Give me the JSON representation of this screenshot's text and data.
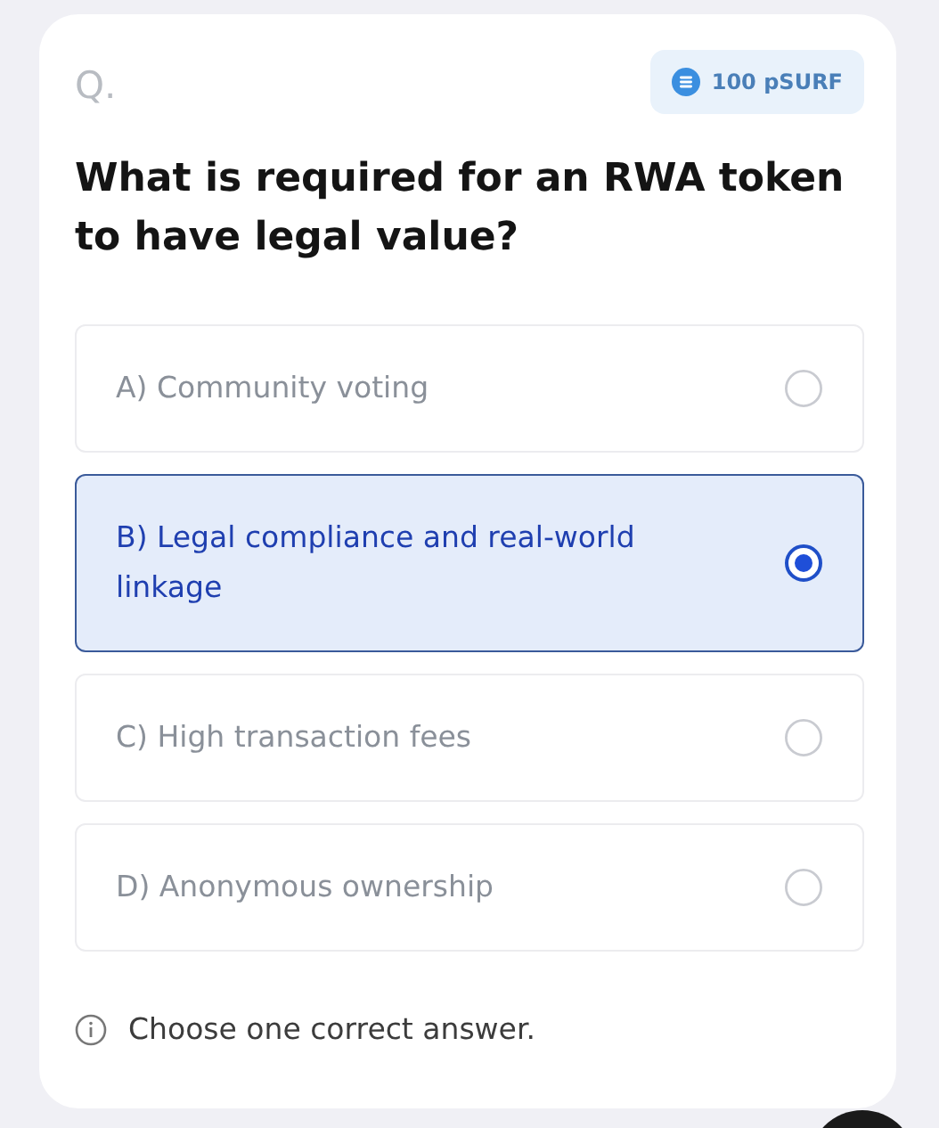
{
  "question": {
    "label": "Q.",
    "reward": "100 pSURF",
    "text": "What is required for an RWA token to have legal value?"
  },
  "options": [
    {
      "text": "A) Community voting",
      "selected": false
    },
    {
      "text": "B) Legal compliance and real-world linkage",
      "selected": true
    },
    {
      "text": "C) High transaction fees",
      "selected": false
    },
    {
      "text": "D) Anonymous ownership",
      "selected": false
    }
  ],
  "hint": "Choose one correct answer."
}
